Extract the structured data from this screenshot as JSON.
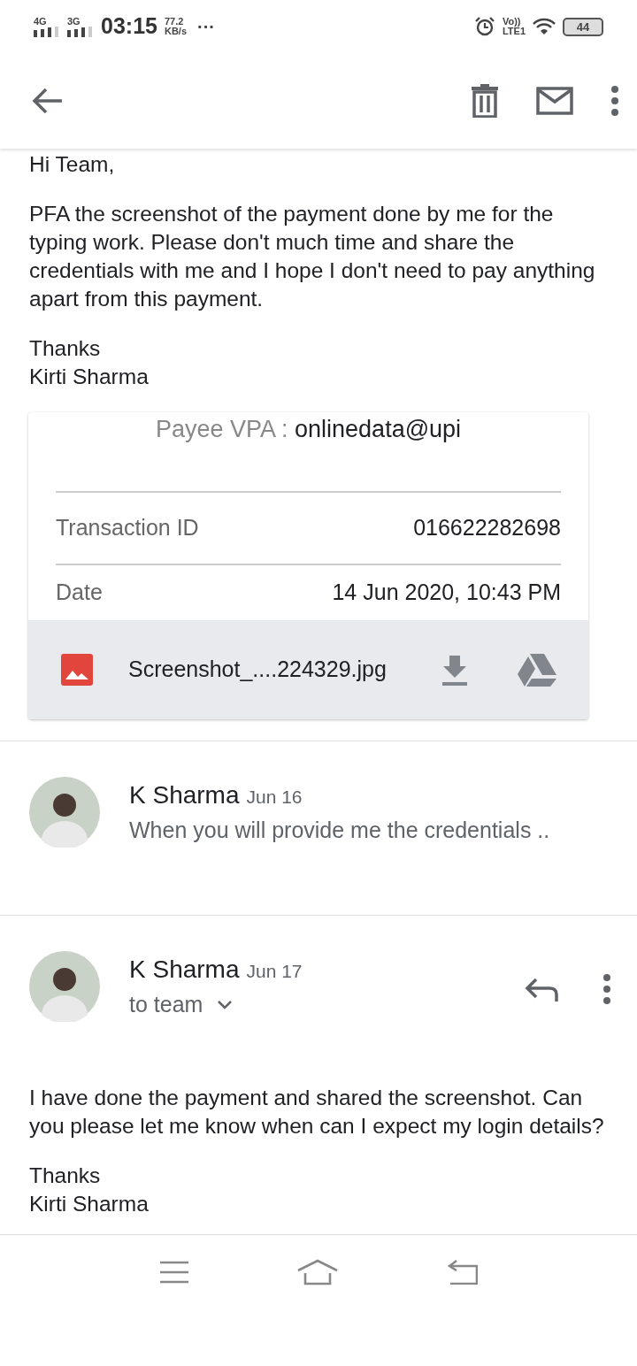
{
  "status_bar": {
    "networks": [
      "4G",
      "3G"
    ],
    "time": "03:15",
    "speed_value": "77.2",
    "speed_unit": "KB/s",
    "more": "···",
    "volte": "Vo))",
    "lte": "LTE1",
    "battery": "44"
  },
  "message_1": {
    "greeting": "Hi Team,",
    "paragraphs": [
      "PFA the screenshot of the payment done by me for the typing work. Please don't much time and share the credentials with me and I hope I don't need to pay anything apart from this payment."
    ],
    "signoff": "Thanks",
    "signature": "Kirti Sharma",
    "attachment": {
      "payee_label": "Payee VPA :",
      "payee_value": "onlinedata@upi",
      "rows": [
        {
          "label": "Transaction ID",
          "value": "016622282698"
        },
        {
          "label": "Date",
          "value": "14 Jun 2020, 10:43 PM"
        }
      ],
      "file_name": "Screenshot_....224329.jpg"
    }
  },
  "message_2": {
    "sender": "K Sharma",
    "date": "Jun 16",
    "snippet": "When you will provide me the credentials .."
  },
  "message_3": {
    "sender": "K Sharma",
    "date": "Jun 17",
    "recipients": "to team",
    "paragraphs": [
      "I have done the payment and shared the screenshot. Can you please let me know when can I expect my login details?"
    ],
    "signoff": "Thanks",
    "signature": "Kirti Sharma"
  }
}
